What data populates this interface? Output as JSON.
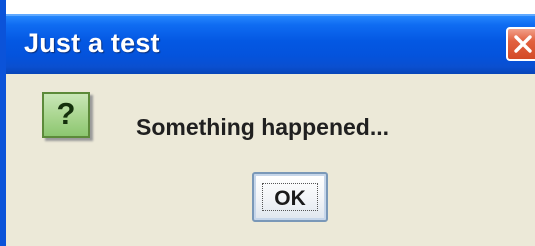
{
  "window": {
    "title": "Just a test",
    "close_icon": "close-icon"
  },
  "dialog": {
    "icon": "question-icon",
    "icon_glyph": "?",
    "message": "Something happened...",
    "ok_label": "OK"
  },
  "colors": {
    "titlebar": "#0458e3",
    "close_button": "#d34a27",
    "dialog_background": "#ece9d8",
    "icon_background": "#a8d58e"
  }
}
